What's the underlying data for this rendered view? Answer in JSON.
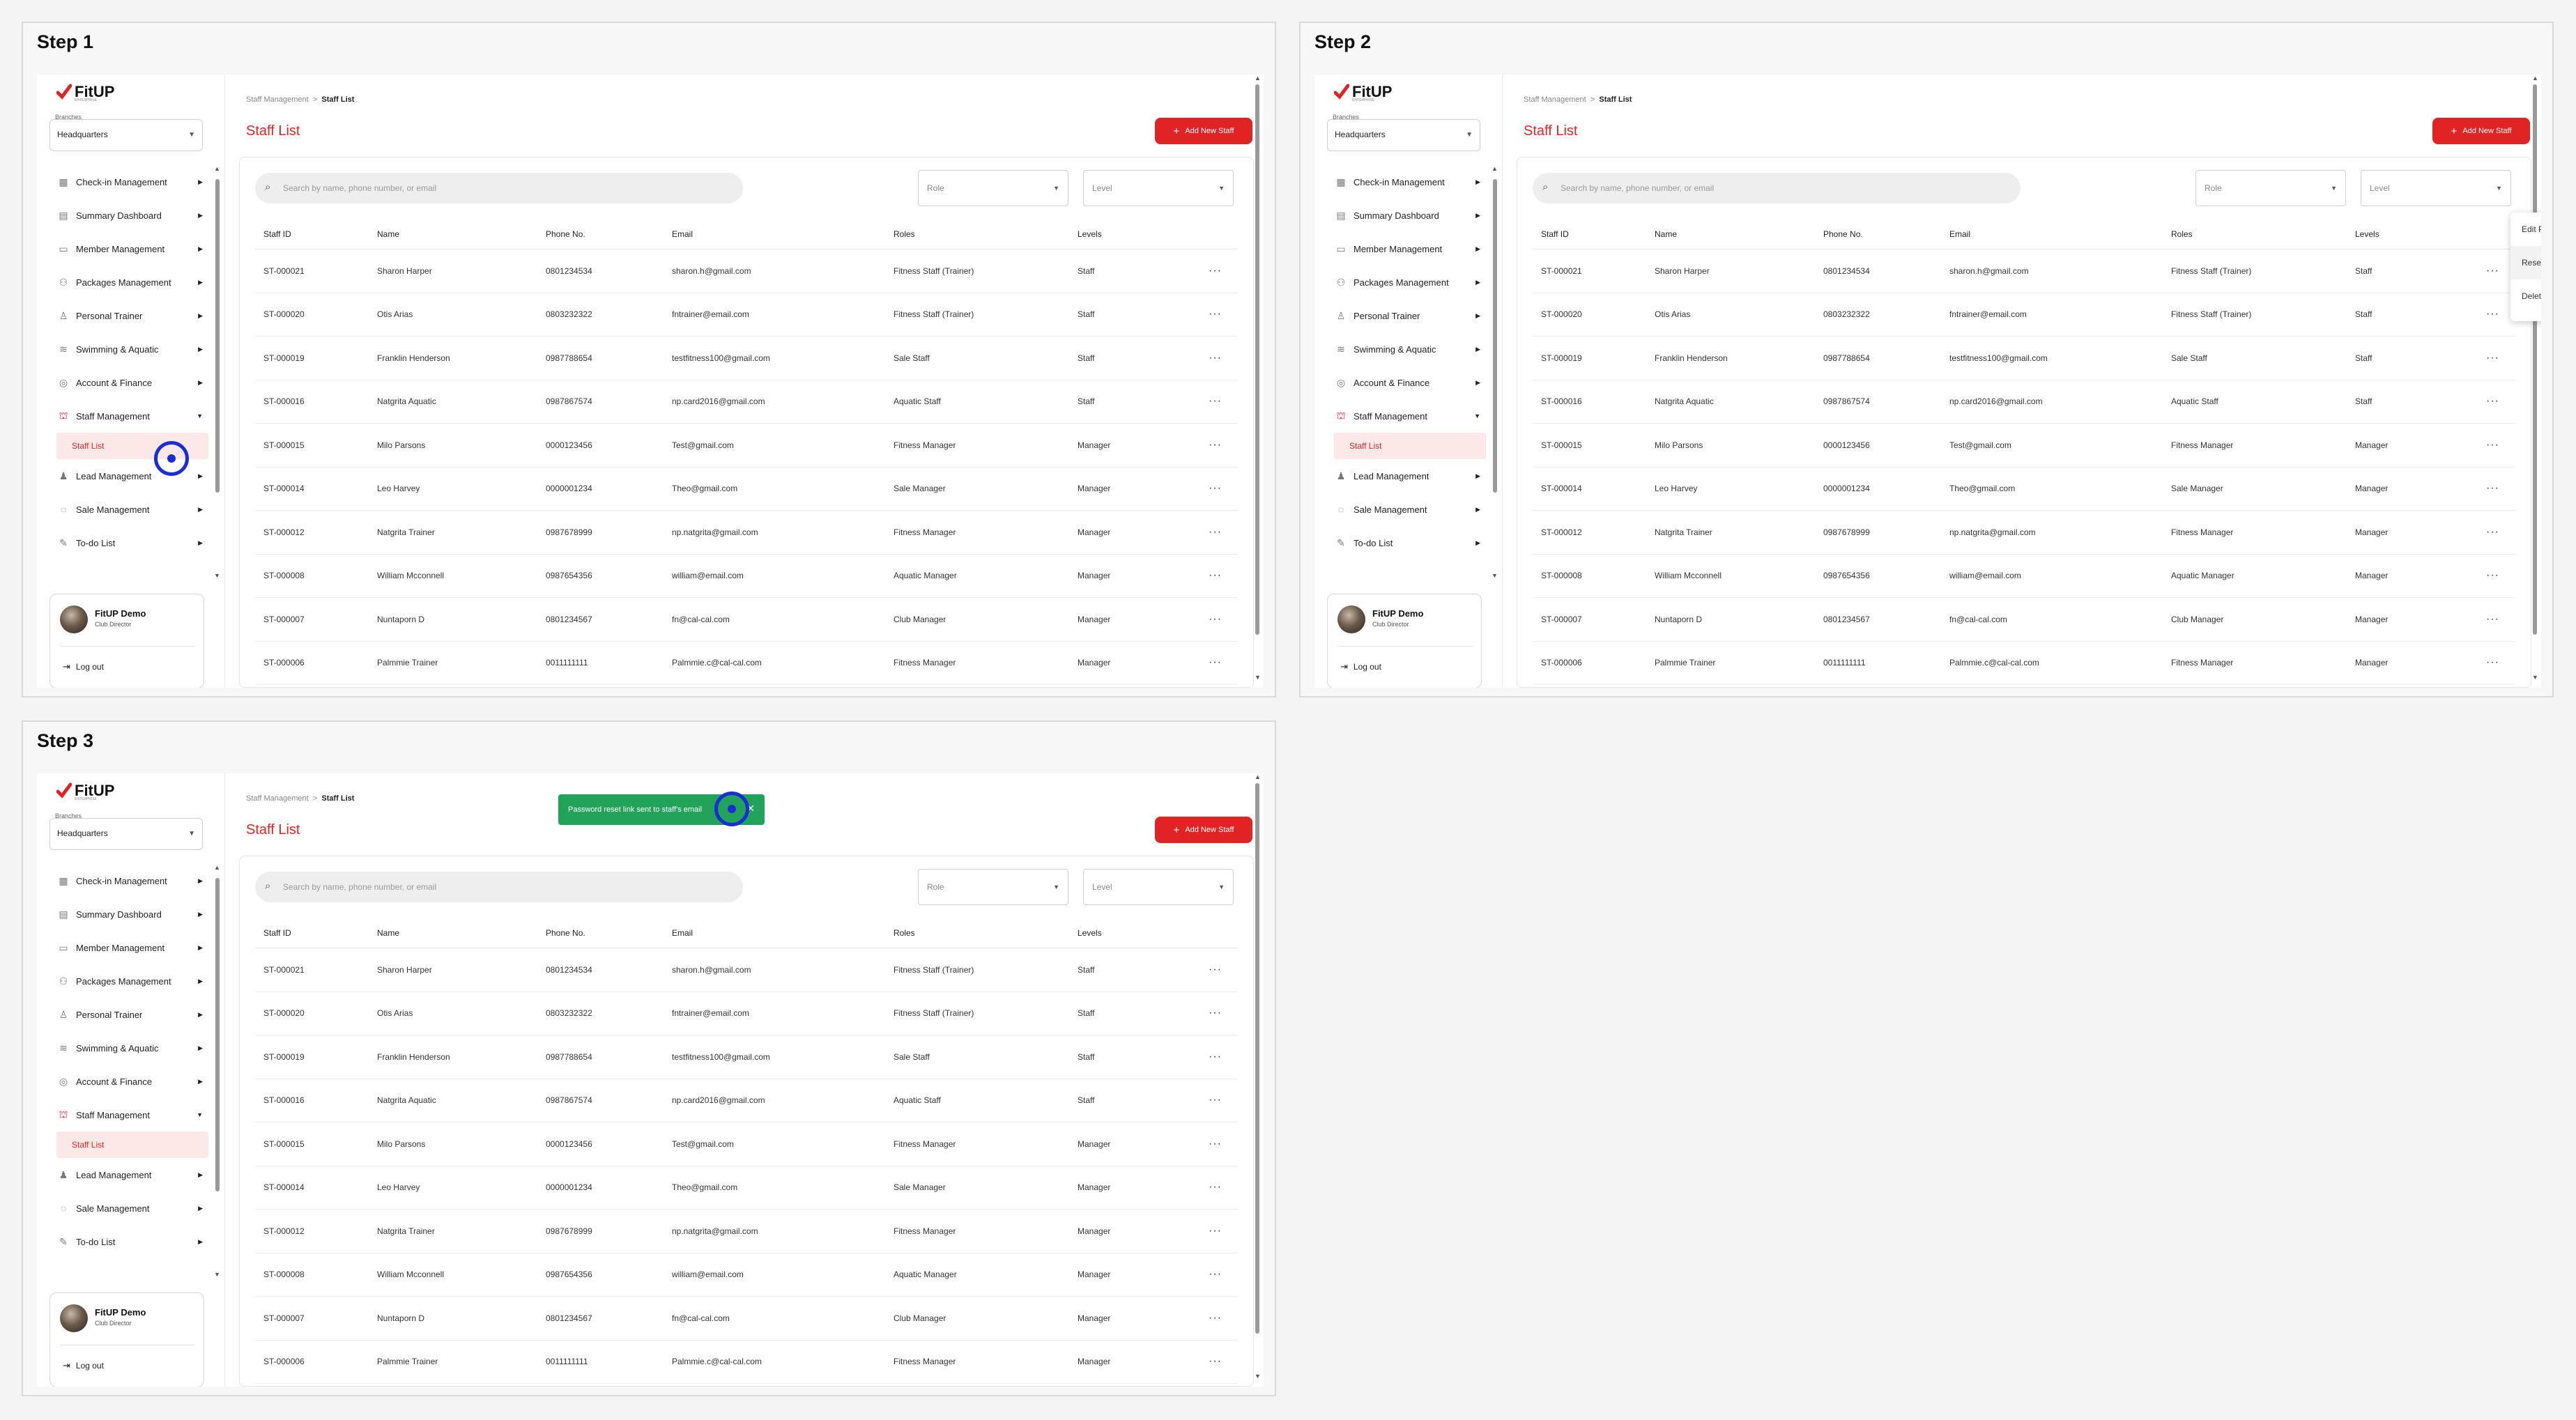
{
  "steps": [
    {
      "title": "Step 1"
    },
    {
      "title": "Step 2"
    },
    {
      "title": "Step 3"
    }
  ],
  "app": {
    "logo": "FitUP",
    "logo_sub": "ENTERPRISE",
    "branch_label": "Branches",
    "branch_value": "Headquarters",
    "menu": [
      {
        "label": "Check-in Management",
        "icon": "qr-icon"
      },
      {
        "label": "Summary Dashboard",
        "icon": "dashboard-icon"
      },
      {
        "label": "Member Management",
        "icon": "member-card-icon"
      },
      {
        "label": "Packages Management",
        "icon": "package-icon"
      },
      {
        "label": "Personal Trainer",
        "icon": "trainer-icon"
      },
      {
        "label": "Swimming & Aquatic",
        "icon": "swim-icon"
      },
      {
        "label": "Account & Finance",
        "icon": "finance-icon"
      },
      {
        "label": "Staff Management",
        "icon": "staff-icon"
      },
      {
        "label": "Lead Management",
        "icon": "lead-icon"
      },
      {
        "label": "Sale Management",
        "icon": "sale-icon"
      },
      {
        "label": "To-do List",
        "icon": "todo-icon"
      }
    ],
    "submenu_label": "Staff List",
    "user": {
      "name": "FitUP Demo",
      "role": "Club Director",
      "logout": "Log out"
    },
    "breadcrumb": {
      "parent": "Staff Management",
      "separator": ">",
      "current": "Staff List"
    },
    "page_title": "Staff List",
    "add_button": "Add New Staff",
    "search_placeholder": "Search by name, phone number, or email",
    "filter_role": "Role",
    "filter_level": "Level",
    "columns": [
      "Staff ID",
      "Name",
      "Phone No.",
      "Email",
      "Roles",
      "Levels"
    ],
    "rows": [
      [
        "ST-000021",
        "Sharon Harper",
        "0801234534",
        "sharon.h@gmail.com",
        "Fitness Staff (Trainer)",
        "Staff"
      ],
      [
        "ST-000020",
        "Otis Arias",
        "0803232322",
        "fntrainer@email.com",
        "Fitness Staff (Trainer)",
        "Staff"
      ],
      [
        "ST-000019",
        "Franklin Henderson",
        "0987788654",
        "testfitness100@gmail.com",
        "Sale Staff",
        "Staff"
      ],
      [
        "ST-000016",
        "Natgrita Aquatic",
        "0987867574",
        "np.card2016@gmail.com",
        "Aquatic Staff",
        "Staff"
      ],
      [
        "ST-000015",
        "Milo Parsons",
        "0000123456",
        "Test@gmail.com",
        "Fitness Manager",
        "Manager"
      ],
      [
        "ST-000014",
        "Leo Harvey",
        "0000001234",
        "Theo@gmail.com",
        "Sale Manager",
        "Manager"
      ],
      [
        "ST-000012",
        "Natgrita Trainer",
        "0987678999",
        "np.natgrita@gmail.com",
        "Fitness Manager",
        "Manager"
      ],
      [
        "ST-000008",
        "William Mcconnell",
        "0987654356",
        "william@email.com",
        "Aquatic Manager",
        "Manager"
      ],
      [
        "ST-000007",
        "Nuntaporn D",
        "0801234567",
        "fn@cal-cal.com",
        "Club Manager",
        "Manager"
      ],
      [
        "ST-000006",
        "Palmmie Trainer",
        "0011111111",
        "Palmmie.c@cal-cal.com",
        "Fitness Manager",
        "Manager"
      ]
    ],
    "row_actions": [
      "Edit Profile",
      "Reset Password",
      "Delete Staff"
    ],
    "toast": "Password reset link sent to staff's email"
  },
  "colors": {
    "accent": "#e02424",
    "success": "#22a35a",
    "click_marker": "#1a2dd6"
  }
}
